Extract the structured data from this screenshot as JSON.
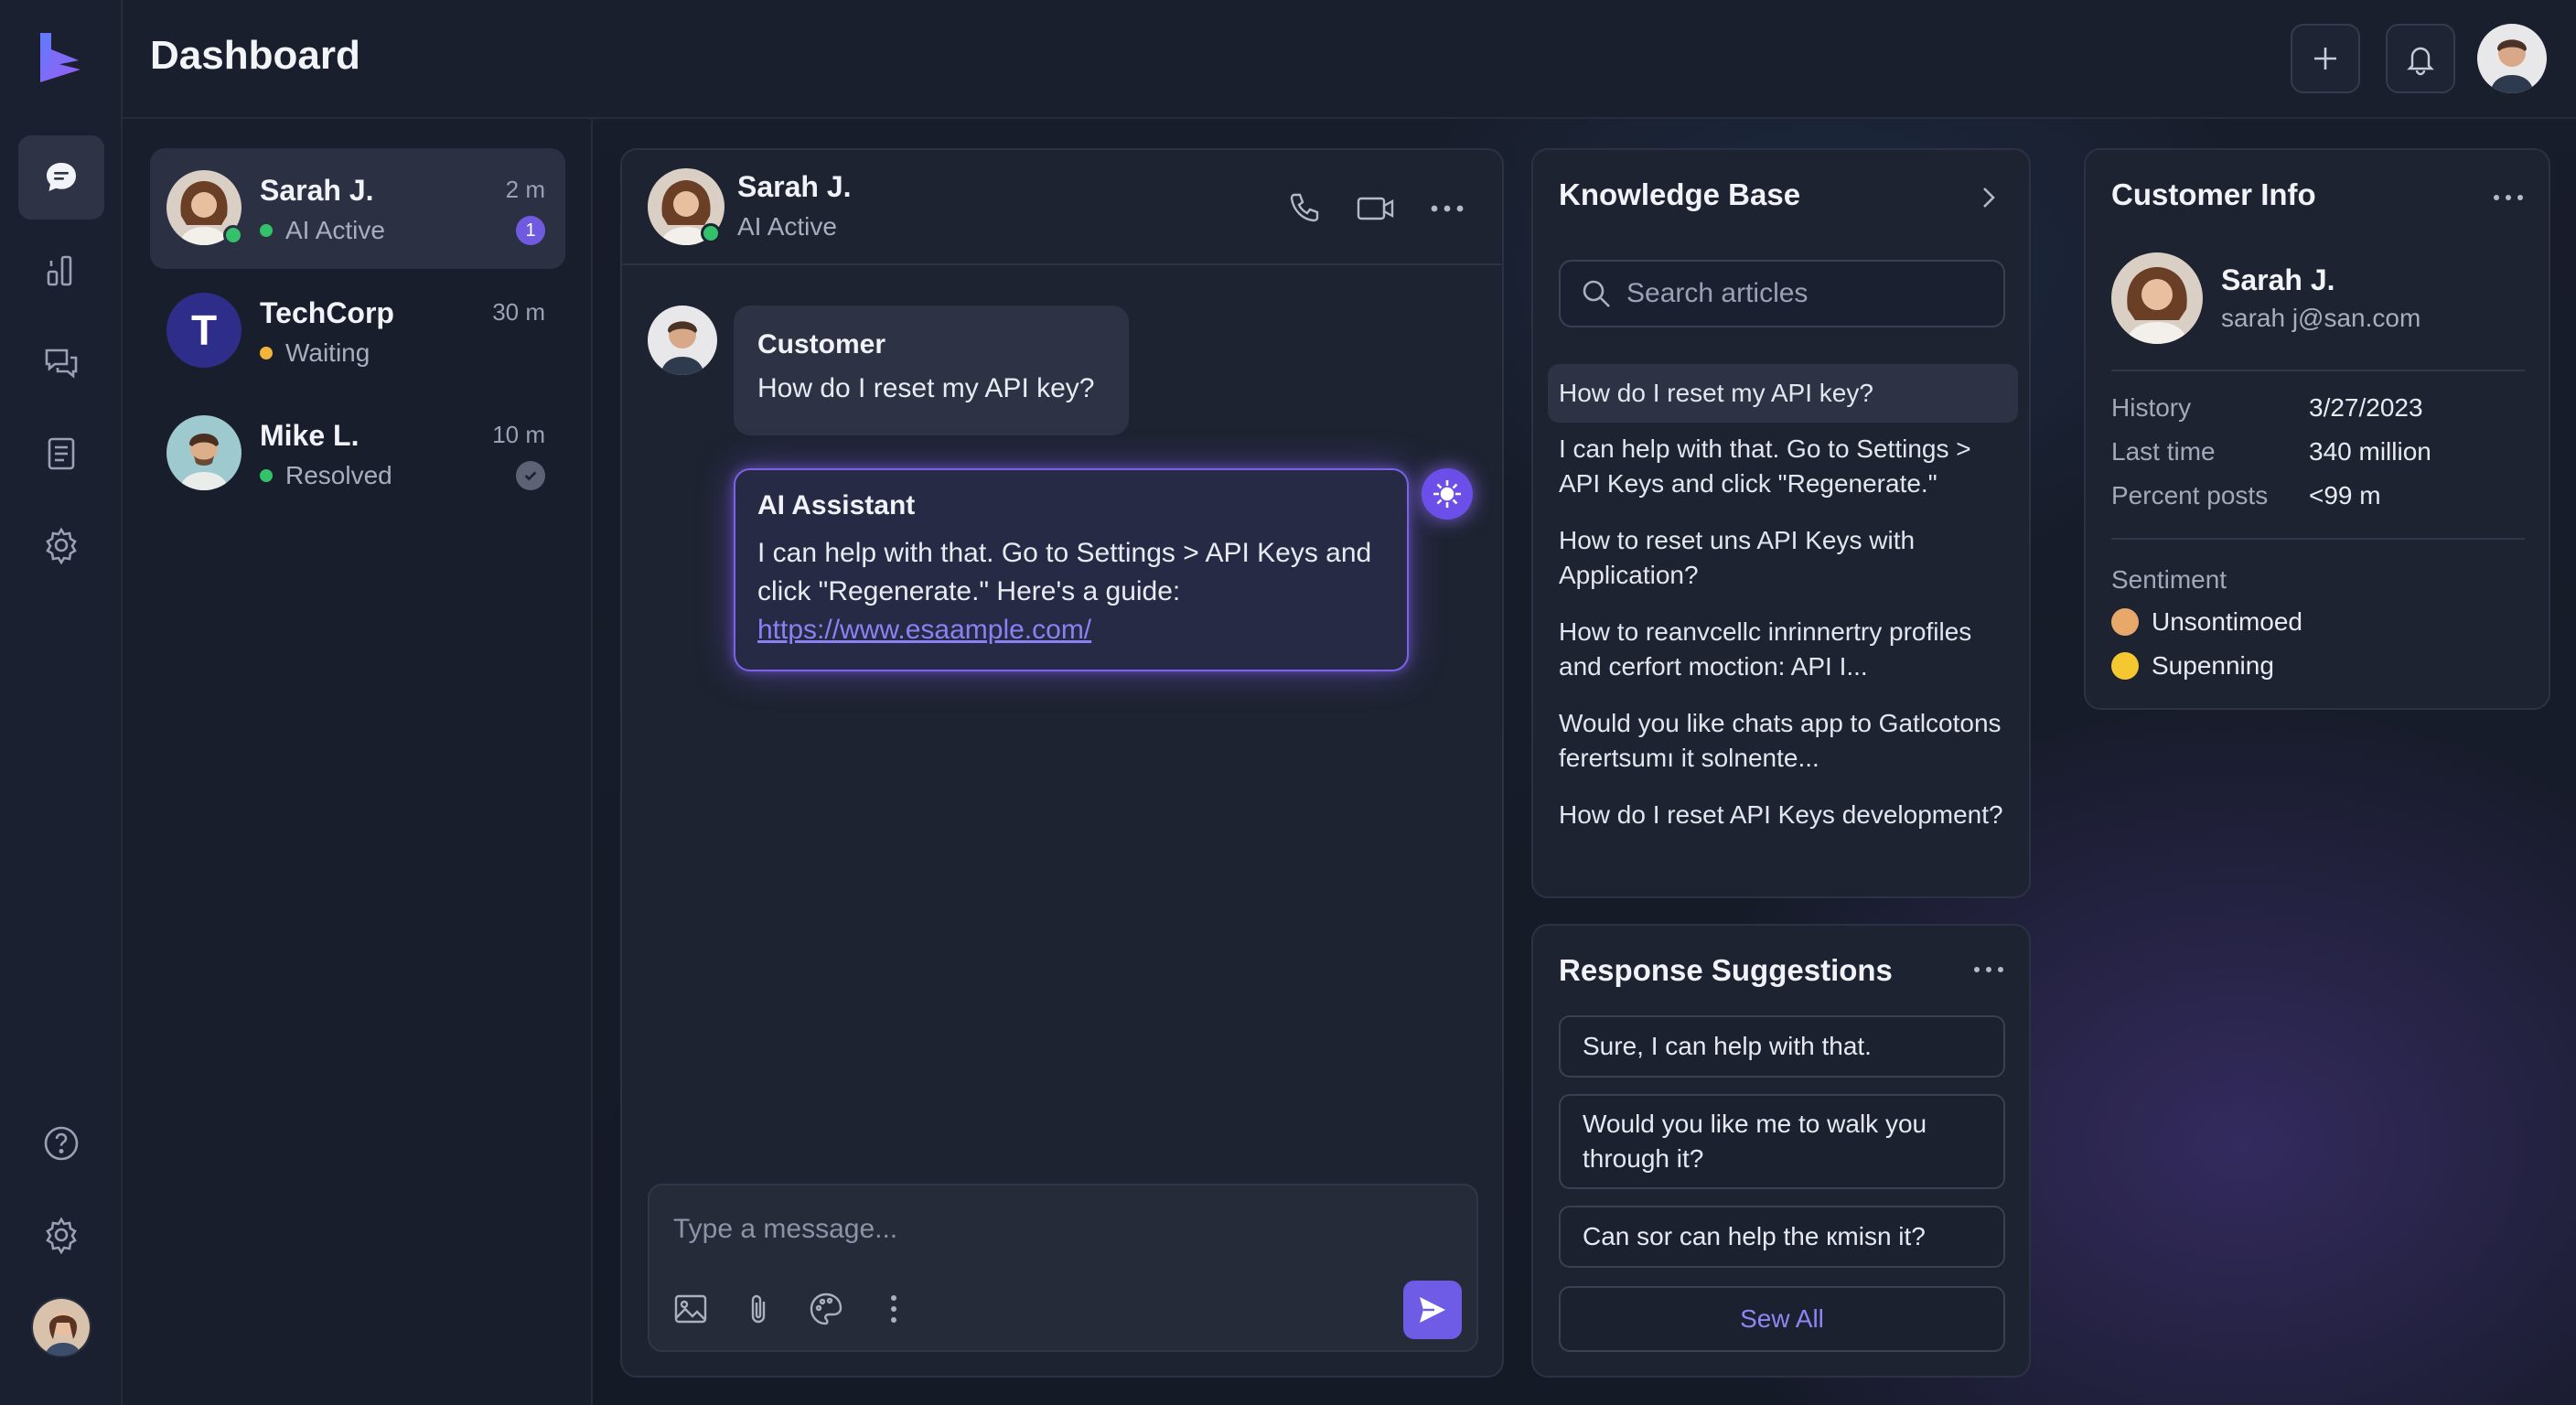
{
  "app": {
    "title": "Dashboard"
  },
  "rail": {
    "items": [
      {
        "icon": "chat-bubble-icon",
        "active": true
      },
      {
        "icon": "analytics-icon"
      },
      {
        "icon": "messages-icon"
      },
      {
        "icon": "document-icon"
      },
      {
        "icon": "gear-icon"
      }
    ],
    "bottom": [
      {
        "icon": "help-icon"
      },
      {
        "icon": "gear-icon"
      }
    ]
  },
  "conversations": [
    {
      "name": "Sarah J.",
      "status": "AI Active",
      "status_color": "#33c16a",
      "time": "2 m",
      "unread": "1",
      "active": true
    },
    {
      "name": "TechCorp",
      "status": "Waiting",
      "status_color": "#f2b53a",
      "time": "30 m",
      "logo_letter": "T"
    },
    {
      "name": "Mike L.",
      "status": "Resolved",
      "status_color": "#33c16a",
      "time": "10 m",
      "resolved": true
    }
  ],
  "chat": {
    "header": {
      "name": "Sarah J.",
      "status": "AI Active"
    },
    "messages": [
      {
        "sender": "Customer",
        "text": "How do I reset my API key?"
      },
      {
        "sender": "AI Assistant",
        "text": "I can help with that. Go to Settings > API Keys and click \"Regenerate.\" Here's a guide:",
        "link": "https://www.esaample.com/"
      }
    ],
    "composer": {
      "placeholder": "Type a message..."
    }
  },
  "knowledge_base": {
    "title": "Knowledge Base",
    "search_placeholder": "Search articles",
    "articles": [
      "How do I reset my API key?",
      "I can help with that. Go to Settings > API Keys and click \"Regenerate.\"",
      "How to reset uns API Keys with Application?",
      "How to reanvcellc inrinnertry profiles and cerfort moction: API I...",
      "Would you like chats app to Gatlcotons ferertsumı it solnente...",
      "How do I reset API Keys development?"
    ]
  },
  "response_suggestions": {
    "title": "Response Suggestions",
    "items": [
      "Sure, I can help with that.",
      "Would you like me to walk you through it?",
      "Can sor can help the кmisn it?"
    ],
    "see_all": "Sew All"
  },
  "customer_info": {
    "title": "Customer Info",
    "name": "Sarah J.",
    "email": "sarah j@san.com",
    "fields": [
      {
        "label": "History",
        "value": "3/27/2023"
      },
      {
        "label": "Last time",
        "value": "340 million"
      },
      {
        "label": "Percent posts",
        "value": "<99 m"
      }
    ],
    "sentiment_label": "Sentiment",
    "sentiments": [
      {
        "label": "Unsontimoed",
        "color": "#e8a86a"
      },
      {
        "label": "Supenning",
        "color": "#f5c832"
      }
    ]
  },
  "colors": {
    "accent": "#6f5ce6",
    "online": "#33c16a",
    "waiting": "#f2b53a",
    "link": "#8a82f2"
  }
}
